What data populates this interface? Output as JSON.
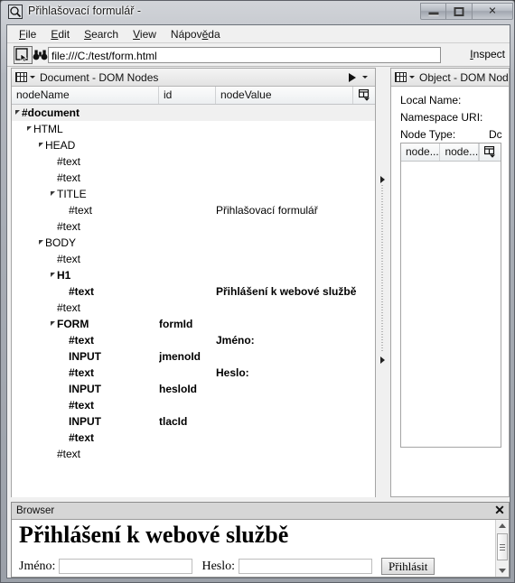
{
  "window": {
    "title": "Přihlašovací formulář -",
    "icon": "magnifier-icon",
    "buttons": {
      "minimize": "minimize",
      "maximize": "maximize",
      "close": "✕"
    }
  },
  "menubar": {
    "items": [
      {
        "label": "File",
        "mnemonic": "F"
      },
      {
        "label": "Edit",
        "mnemonic": "E"
      },
      {
        "label": "Search",
        "mnemonic": "S"
      },
      {
        "label": "View",
        "mnemonic": "V"
      },
      {
        "label": "Nápověda",
        "mnemonic": "ě"
      }
    ]
  },
  "toolbar": {
    "inspect_toggle": "inspect-cursor-icon",
    "find": "binoculars-icon",
    "address_value": "file:///C:/test/form.html",
    "address_placeholder": "file:///",
    "inspect_label": "Inspect",
    "inspect_mnemonic": "I"
  },
  "dom_panel": {
    "title": "Document - DOM Nodes",
    "columns": [
      "nodeName",
      "id",
      "nodeValue"
    ],
    "rows": [
      {
        "depth": 0,
        "twisty": true,
        "name": "#document",
        "id": "",
        "value": "",
        "bold": true,
        "selected": true
      },
      {
        "depth": 1,
        "twisty": true,
        "name": "HTML",
        "id": "",
        "value": "",
        "bold": false,
        "selected": false
      },
      {
        "depth": 2,
        "twisty": true,
        "name": "HEAD",
        "id": "",
        "value": "",
        "bold": false,
        "selected": false
      },
      {
        "depth": 3,
        "twisty": false,
        "name": "#text",
        "id": "",
        "value": "",
        "bold": false,
        "selected": false
      },
      {
        "depth": 3,
        "twisty": false,
        "name": "#text",
        "id": "",
        "value": "",
        "bold": false,
        "selected": false
      },
      {
        "depth": 3,
        "twisty": true,
        "name": "TITLE",
        "id": "",
        "value": "",
        "bold": false,
        "selected": false
      },
      {
        "depth": 4,
        "twisty": false,
        "name": "#text",
        "id": "",
        "value": "Přihlašovací formulář",
        "bold": false,
        "selected": false
      },
      {
        "depth": 3,
        "twisty": false,
        "name": "#text",
        "id": "",
        "value": "",
        "bold": false,
        "selected": false
      },
      {
        "depth": 2,
        "twisty": true,
        "name": "BODY",
        "id": "",
        "value": "",
        "bold": false,
        "selected": false
      },
      {
        "depth": 3,
        "twisty": false,
        "name": "#text",
        "id": "",
        "value": "",
        "bold": false,
        "selected": false
      },
      {
        "depth": 3,
        "twisty": true,
        "name": "H1",
        "id": "",
        "value": "",
        "bold": true,
        "selected": false
      },
      {
        "depth": 4,
        "twisty": false,
        "name": "#text",
        "id": "",
        "value": "Přihlášení k webové službě",
        "bold": true,
        "selected": false
      },
      {
        "depth": 3,
        "twisty": false,
        "name": "#text",
        "id": "",
        "value": "",
        "bold": false,
        "selected": false
      },
      {
        "depth": 3,
        "twisty": true,
        "name": "FORM",
        "id": "formId",
        "value": "",
        "bold": true,
        "selected": false
      },
      {
        "depth": 4,
        "twisty": false,
        "name": "#text",
        "id": "",
        "value": "Jméno:",
        "bold": true,
        "selected": false
      },
      {
        "depth": 4,
        "twisty": false,
        "name": "INPUT",
        "id": "jmenoId",
        "value": "",
        "bold": true,
        "selected": false
      },
      {
        "depth": 4,
        "twisty": false,
        "name": "#text",
        "id": "",
        "value": "Heslo:",
        "bold": true,
        "selected": false
      },
      {
        "depth": 4,
        "twisty": false,
        "name": "INPUT",
        "id": "hesloId",
        "value": "",
        "bold": true,
        "selected": false
      },
      {
        "depth": 4,
        "twisty": false,
        "name": "#text",
        "id": "",
        "value": "",
        "bold": true,
        "selected": false
      },
      {
        "depth": 4,
        "twisty": false,
        "name": "INPUT",
        "id": "tlacId",
        "value": "",
        "bold": true,
        "selected": false
      },
      {
        "depth": 4,
        "twisty": false,
        "name": "#text",
        "id": "",
        "value": "",
        "bold": true,
        "selected": false
      },
      {
        "depth": 3,
        "twisty": false,
        "name": "#text",
        "id": "",
        "value": "",
        "bold": false,
        "selected": false
      }
    ]
  },
  "object_panel": {
    "title": "Object - DOM Nod",
    "properties": [
      {
        "label": "Local Name:",
        "value": ""
      },
      {
        "label": "Namespace URI:",
        "value": ""
      },
      {
        "label": "Node Type:",
        "value": "Dc"
      }
    ],
    "attr_columns": [
      "node...",
      "node..."
    ],
    "attr_rows": []
  },
  "browser_panel": {
    "title": "Browser",
    "close": "✕",
    "page": {
      "heading": "Přihlášení k webové službě",
      "name_label": "Jméno:",
      "name_value": "",
      "password_label": "Heslo:",
      "password_value": "",
      "submit_label": "Přihlásit"
    }
  }
}
